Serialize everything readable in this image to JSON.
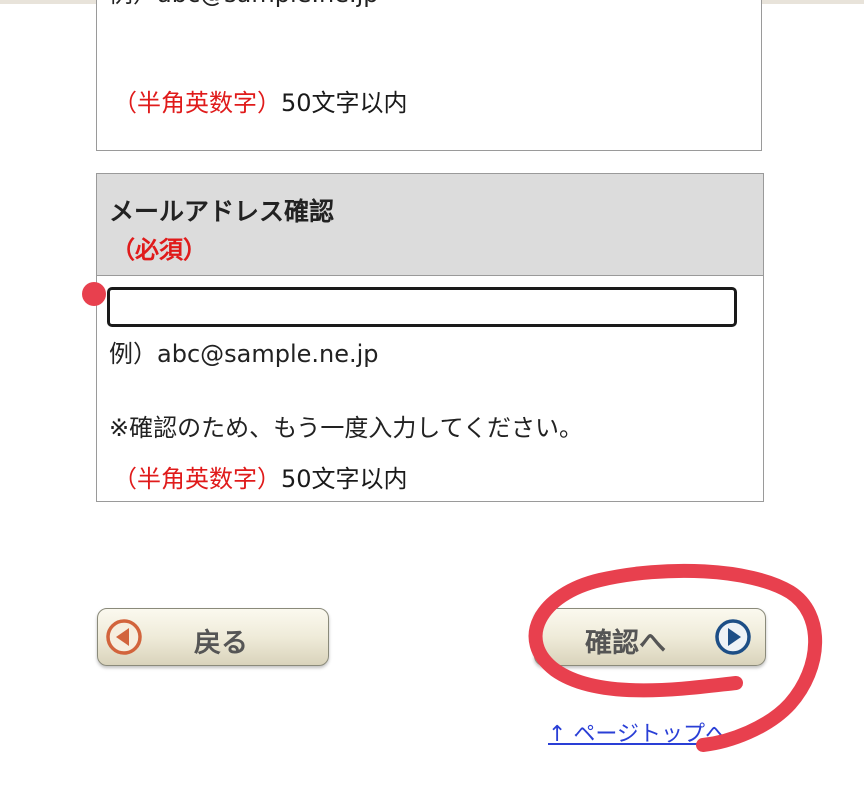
{
  "previous_field": {
    "example_text": "例）abc@sample.ne.jp",
    "format_hint": "（半角英数字）",
    "length_hint": "50文字以内"
  },
  "email_confirm": {
    "label": "メールアドレス確認",
    "required": "（必須）",
    "value": "",
    "example_text": "例）abc@sample.ne.jp",
    "note": "※確認のため、もう一度入力してください。",
    "format_hint": "（半角英数字）",
    "length_hint": "50文字以内"
  },
  "buttons": {
    "back_label": "戻る",
    "confirm_label": "確認へ"
  },
  "links": {
    "page_top": "↑ ページトップへ"
  },
  "colors": {
    "required_red": "#e01b1b",
    "link_blue": "#2a3fd6",
    "annotation_red": "#e8404e"
  },
  "icons": {
    "back": "left-arrow-circle-icon",
    "confirm": "right-arrow-circle-icon"
  }
}
